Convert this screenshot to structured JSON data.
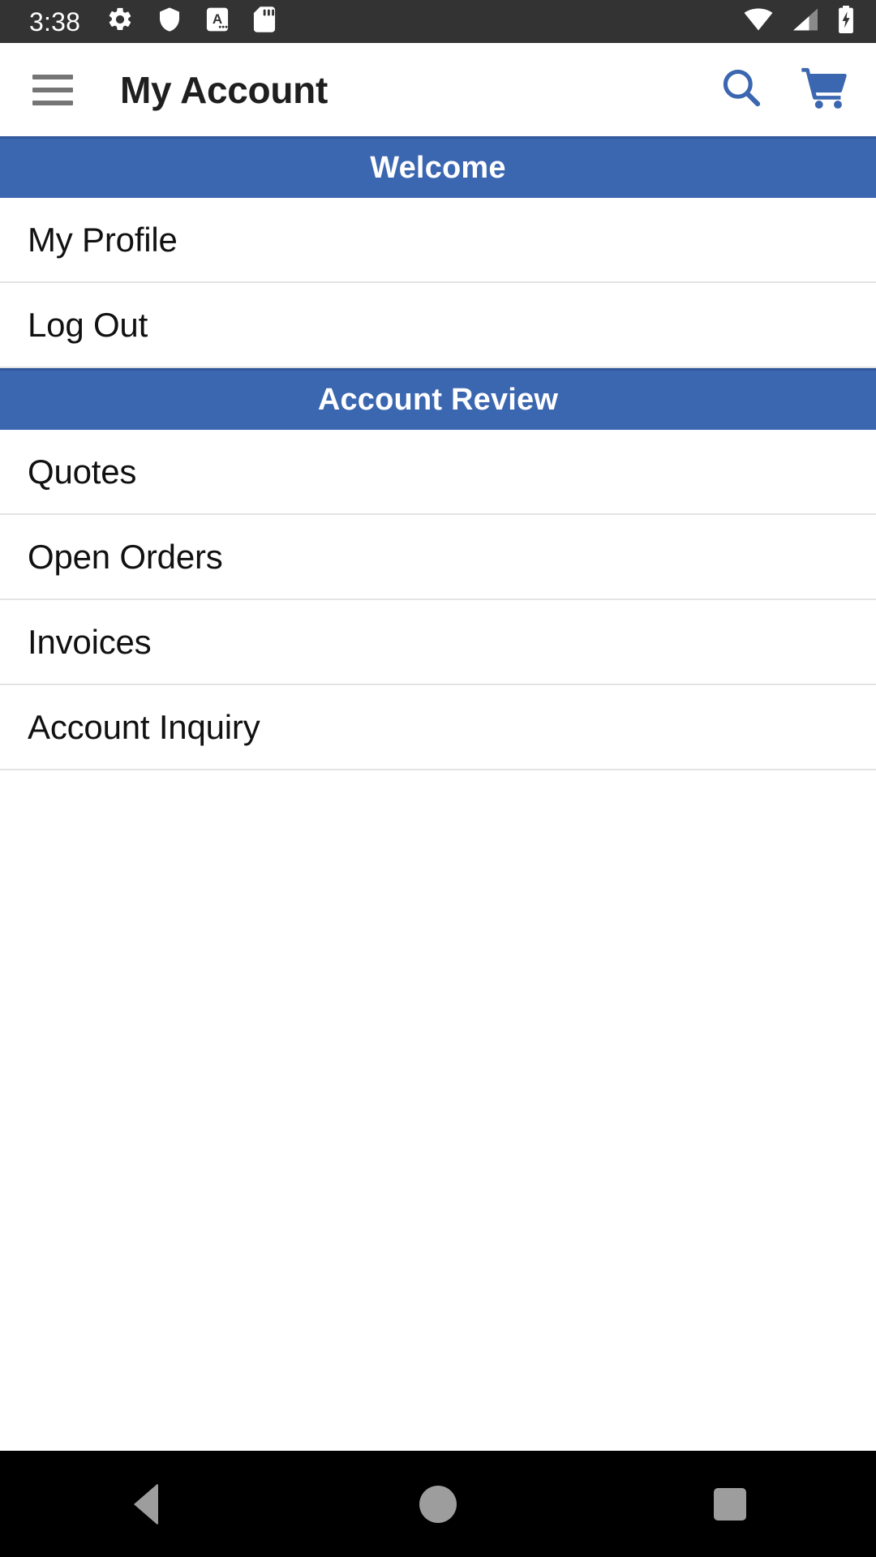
{
  "status_bar": {
    "clock": "3:38",
    "left_icons": [
      "settings-gear-icon",
      "shield-icon",
      "accessibility-a-icon",
      "sd-card-icon"
    ],
    "right_icons": [
      "wifi-icon",
      "cellular-signal-icon",
      "battery-charging-icon"
    ],
    "background_color": "#333333",
    "icon_color": "#ffffff"
  },
  "app_bar": {
    "menu_icon": "hamburger-menu-icon",
    "title": "My Account",
    "actions": [
      {
        "icon": "search-icon",
        "color": "#3b66b0"
      },
      {
        "icon": "shopping-cart-icon",
        "color": "#3b66b0"
      }
    ],
    "background_color": "#ffffff",
    "title_color": "#1f1f1f",
    "menu_icon_color": "#757575"
  },
  "sections": [
    {
      "header": "Welcome",
      "items": [
        {
          "label": "My Profile"
        },
        {
          "label": "Log Out"
        }
      ]
    },
    {
      "header": "Account Review",
      "items": [
        {
          "label": "Quotes"
        },
        {
          "label": "Open Orders"
        },
        {
          "label": "Invoices"
        },
        {
          "label": "Account Inquiry"
        }
      ]
    }
  ],
  "theme": {
    "section_header_bg": "#3b66b0",
    "section_header_text": "#ffffff",
    "list_item_text": "#111111",
    "divider_color": "#e4e4e4",
    "page_background": "#ffffff"
  },
  "nav_bar": {
    "background_color": "#000000",
    "icon_color": "#9d9d9d",
    "buttons": [
      {
        "name": "back-button",
        "icon": "triangle-back-icon"
      },
      {
        "name": "home-button",
        "icon": "circle-home-icon"
      },
      {
        "name": "recents-button",
        "icon": "square-recents-icon"
      }
    ]
  }
}
